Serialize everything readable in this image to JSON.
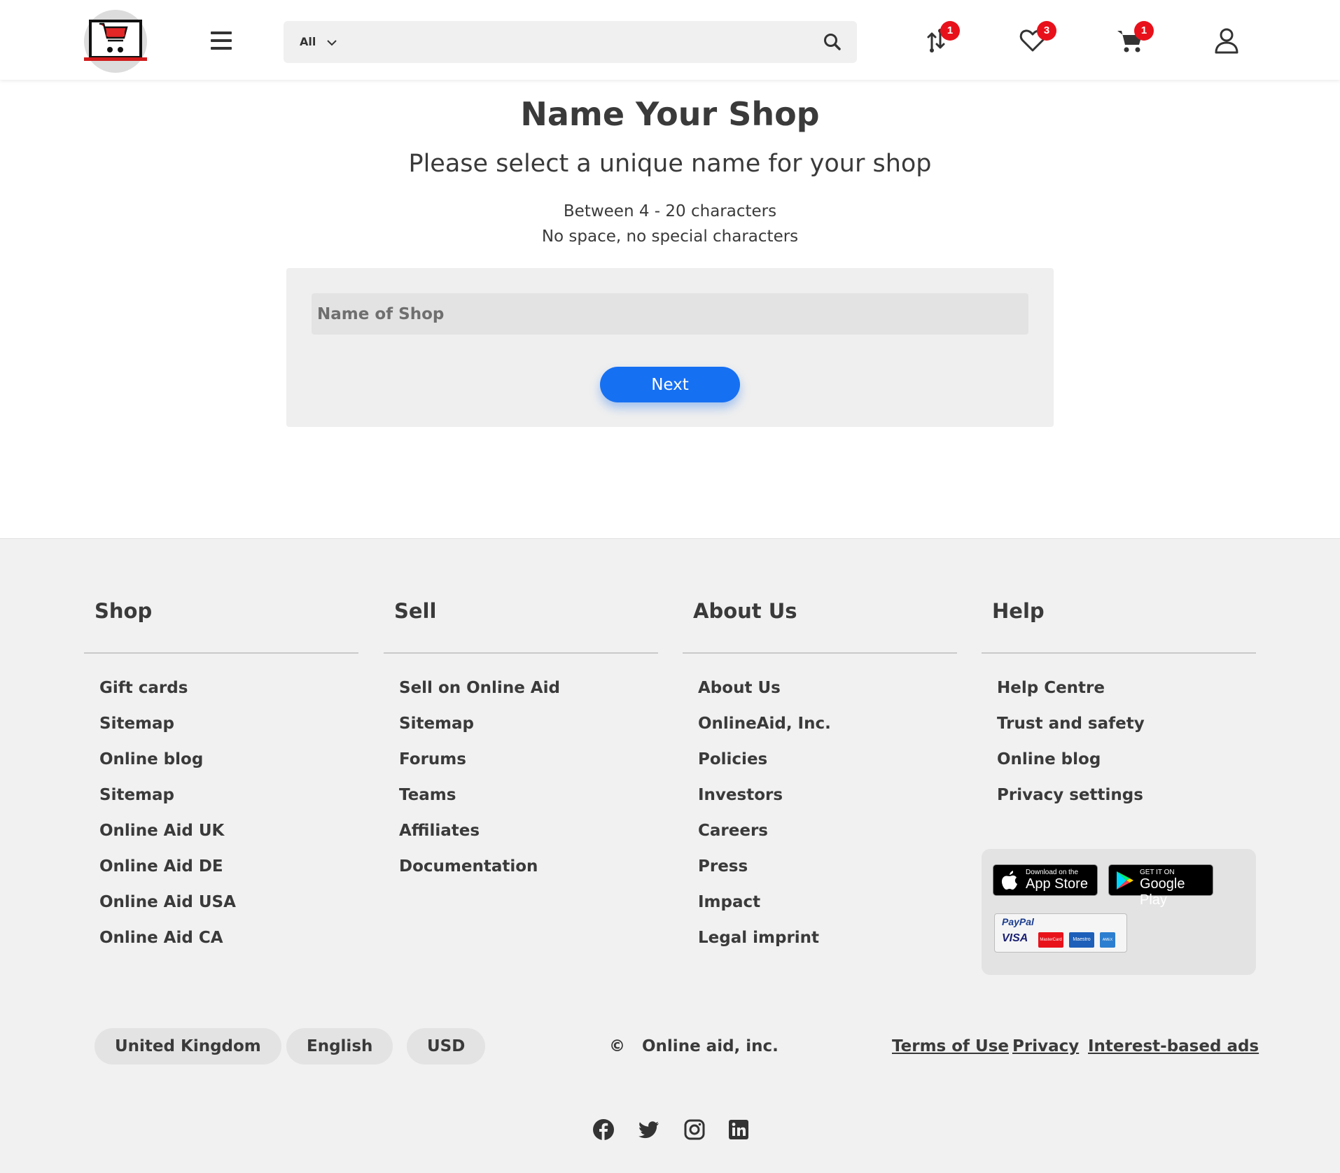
{
  "header": {
    "logo_icon": "shopping-cart-laptop-logo",
    "menu_icon": "hamburger-menu-icon",
    "search": {
      "category": "All",
      "placeholder": ""
    },
    "icons": [
      {
        "name": "compare-icon",
        "badge": "1"
      },
      {
        "name": "heart-icon",
        "badge": "3"
      },
      {
        "name": "cart-icon",
        "badge": "1"
      },
      {
        "name": "user-icon",
        "badge": ""
      }
    ],
    "accent_color": "#e8111b"
  },
  "main": {
    "title": "Name Your Shop",
    "subtitle": "Please select a unique name for your shop",
    "rule_length": "Between 4 - 20 characters",
    "rule_chars": "No space, no special characters",
    "input_placeholder": "Name of Shop",
    "input_value": "",
    "next_label": "Next",
    "button_color": "#1670f2"
  },
  "footer": {
    "columns": [
      {
        "title": "Shop",
        "items": [
          "Gift cards",
          "Sitemap",
          "Online blog",
          "Sitemap",
          "Online Aid UK",
          "Online Aid DE",
          "Online Aid USA",
          "Online Aid CA"
        ]
      },
      {
        "title": "Sell",
        "items": [
          "Sell on Online Aid",
          "Sitemap",
          "Forums",
          "Teams",
          "Affiliates",
          "Documentation"
        ]
      },
      {
        "title": "About Us",
        "items": [
          "About Us",
          "OnlineAid, Inc.",
          "Policies",
          "Investors",
          "Careers",
          "Press",
          "Impact",
          "Legal imprint"
        ]
      },
      {
        "title": "Help",
        "items": [
          "Help Centre",
          "Trust and safety",
          "Online blog",
          "Privacy settings"
        ]
      }
    ],
    "app_store": {
      "small": "Download on the",
      "big": "App Store"
    },
    "google_play": {
      "small": "GET IT ON",
      "big": "Google Play"
    },
    "payment": {
      "paypal": "PayPal",
      "visa": "VISA",
      "mastercard": "MasterCard",
      "maestro": "Maestro",
      "amex": "AMEX"
    },
    "locale": {
      "country": "United Kingdom",
      "language": "English",
      "currency": "USD"
    },
    "copyright": {
      "symbol": "©",
      "text": "Online aid, inc."
    },
    "legal": [
      "Terms of Use",
      "Privacy",
      "Interest-based ads"
    ],
    "social": [
      "facebook-icon",
      "twitter-icon",
      "instagram-icon",
      "linkedin-icon"
    ]
  }
}
